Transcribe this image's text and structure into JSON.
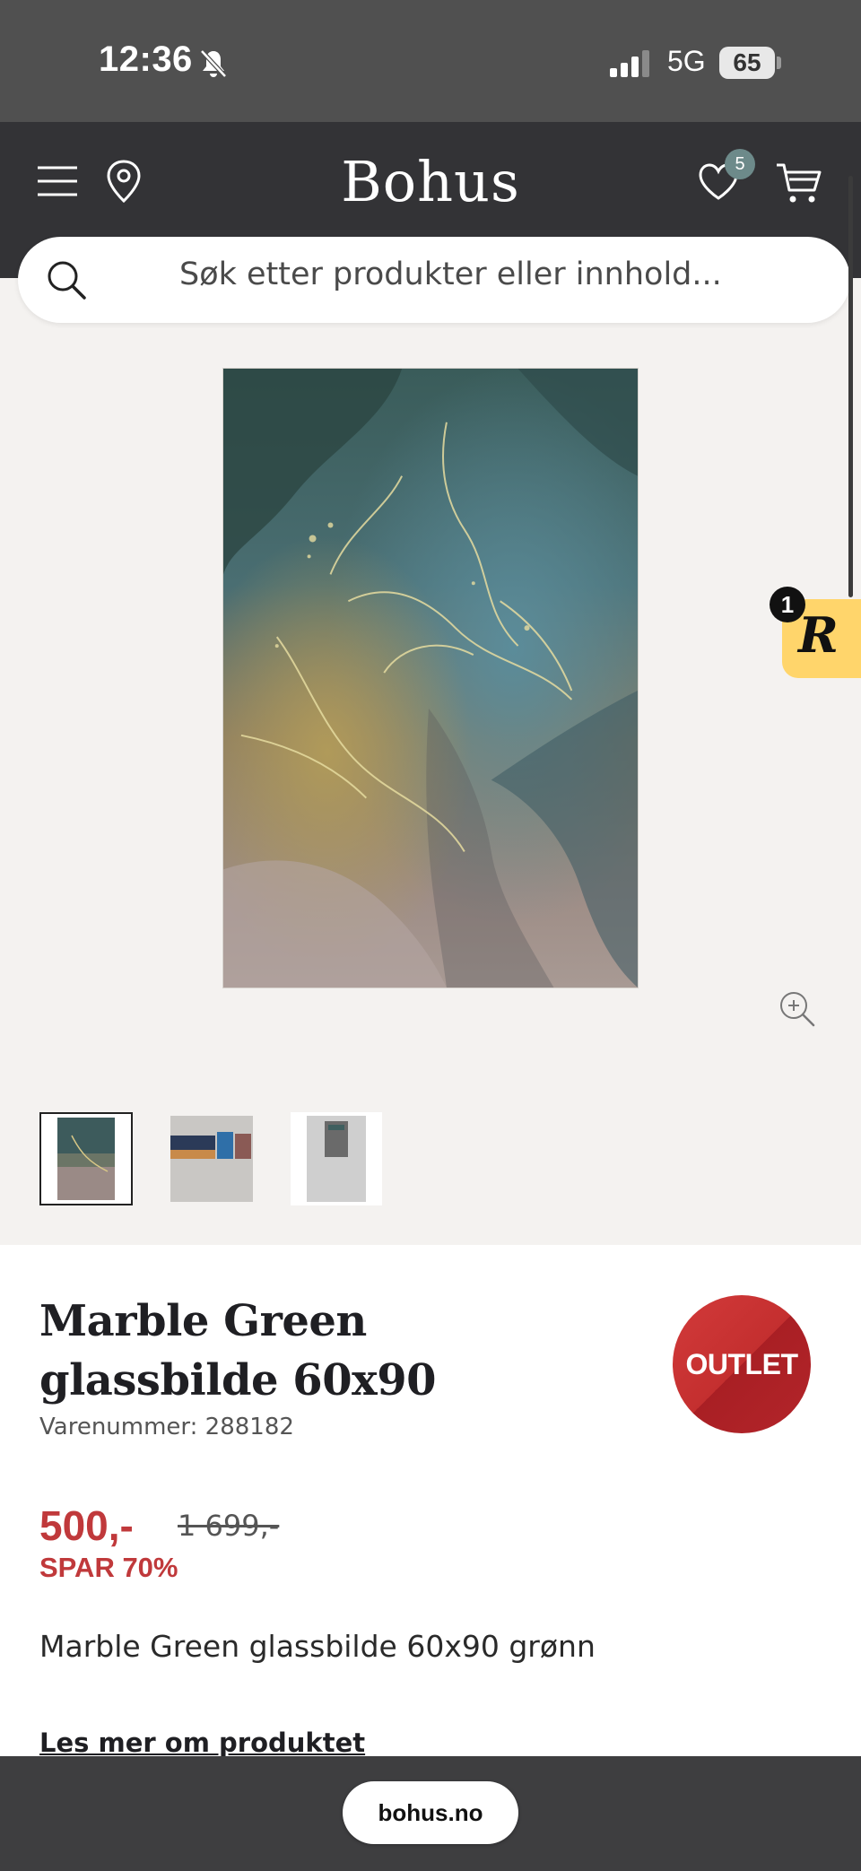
{
  "status_bar": {
    "time": "12:36",
    "network": "5G",
    "battery": "65",
    "icons": [
      "bell-slash-icon",
      "signal-icon"
    ]
  },
  "header": {
    "logo": "Bohus",
    "wishlist_count": "5",
    "icons": [
      "menu-icon",
      "location-pin-icon",
      "heart-icon",
      "cart-icon"
    ]
  },
  "search": {
    "placeholder": "Søk etter produkter eller innhold..."
  },
  "floating_widget": {
    "letter": "R",
    "badge": "1"
  },
  "gallery": {
    "thumbnail_count": 3,
    "selected_index": 0
  },
  "product": {
    "title": "Marble Green glassbilde 60x90",
    "sku": "Varenummer: 288182",
    "badge": "OUTLET",
    "price": "500,-",
    "old_price": "1 699,-",
    "savings": "SPAR 70%",
    "description": "Marble Green glassbilde 60x90 grønn",
    "read_more": "Les mer om produktet"
  },
  "browser": {
    "url": "bohus.no"
  },
  "colors": {
    "header_bg": "#333336",
    "status_bg": "#505050",
    "price_red": "#c0393b",
    "outlet_red": "#c42f2f",
    "widget_yellow": "#ffd56b",
    "page_bg": "#f4f2f0"
  }
}
